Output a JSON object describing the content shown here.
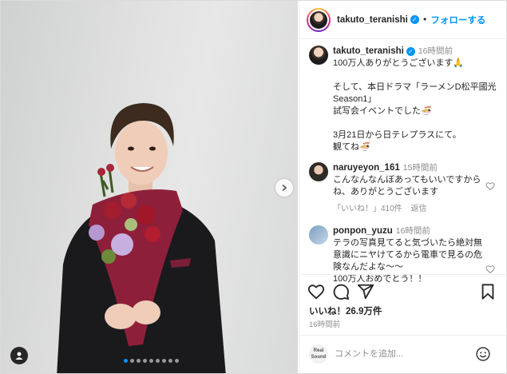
{
  "header": {
    "username": "takuto_teranishi",
    "separator": "•",
    "follow_label": "フォローする"
  },
  "caption": {
    "username": "takuto_teranishi",
    "time": "16時間前",
    "lines": [
      "100万人ありがとうございます🙏",
      "",
      "そして、本日ドラマ「ラーメンD松平國光",
      "Season1」",
      "試写会イベントでした🍜",
      "",
      "3月21日から日テレプラスにて。",
      "観てね🍜"
    ]
  },
  "comments": [
    {
      "username": "naruyeyon_161",
      "time": "15時間前",
      "lines": [
        "こんなんなんぼあってもいいですから",
        "ね、ありがとうございます"
      ],
      "likes": "「いいね！」410件",
      "reply": "返信"
    },
    {
      "username": "ponpon_yuzu",
      "time": "16時間前",
      "lines": [
        "テラの写真見てると気づいたら絶対無",
        "意識にニヤけてるから電車で見るの危",
        "険なんだよな〜〜",
        "100万人おめでとう！！"
      ]
    }
  ],
  "footer": {
    "likes": "いいね！26.9万件",
    "posted": "16時間前",
    "comment_placeholder": "コメントを追加...",
    "logo_text_1": "Real",
    "logo_text_2": "Sound"
  },
  "carousel": {
    "slides": 9,
    "active": 1
  },
  "colors": {
    "accent": "#0095f6",
    "text": "#262626",
    "muted": "#8e8e8e"
  }
}
